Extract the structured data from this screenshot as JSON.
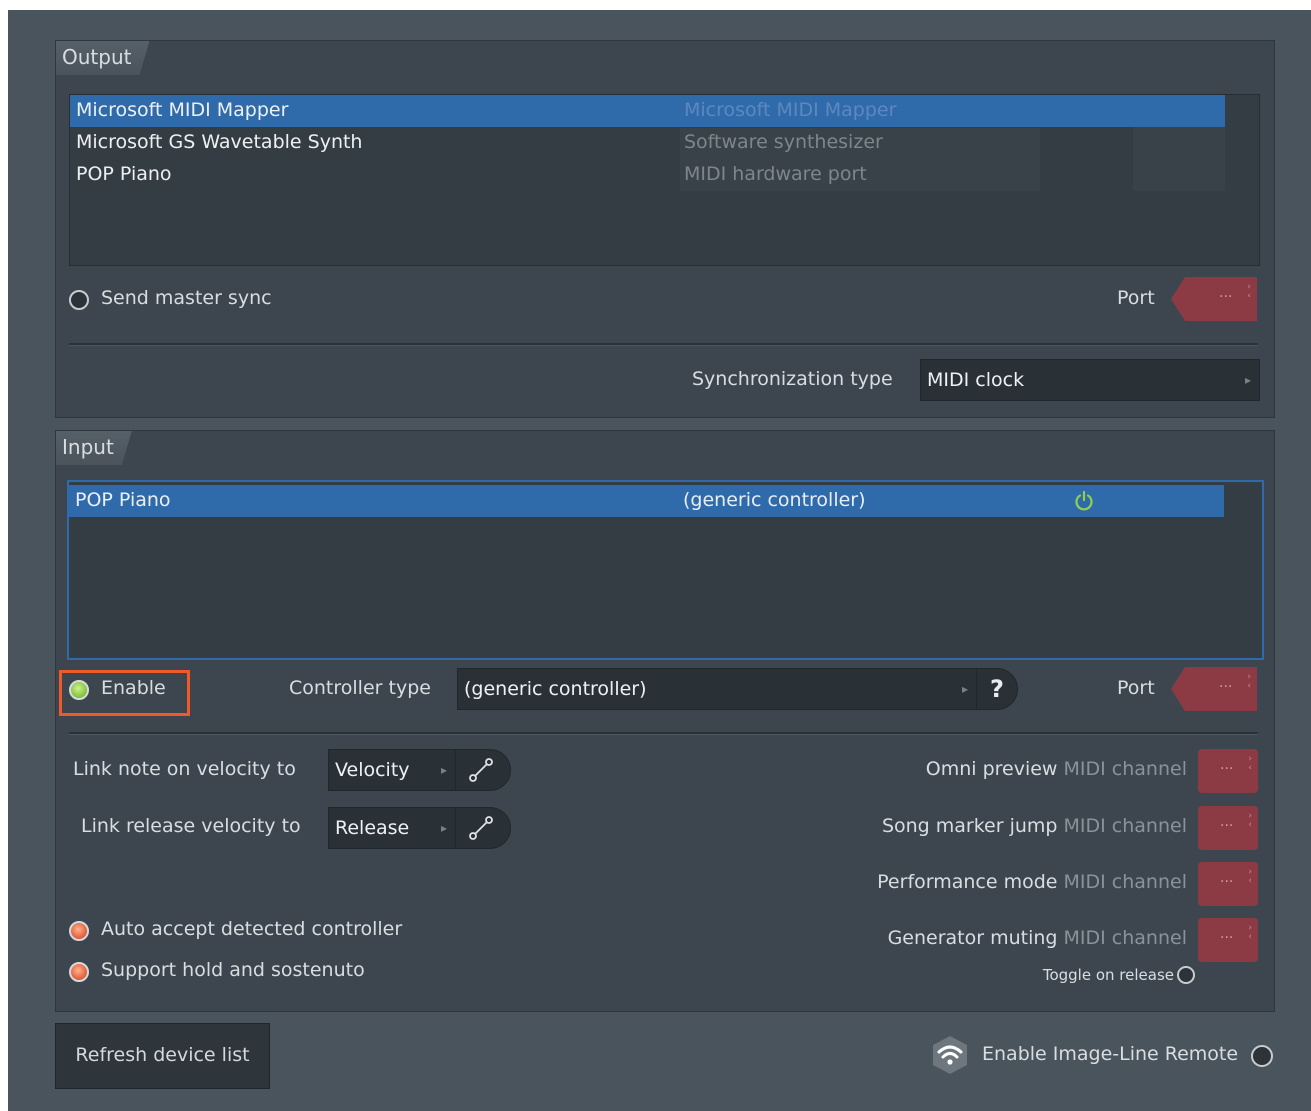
{
  "output": {
    "title": "Output",
    "devices": [
      {
        "name": "Microsoft MIDI Mapper",
        "type": "Microsoft MIDI Mapper",
        "selected": true
      },
      {
        "name": "Microsoft GS Wavetable Synth",
        "type": "Software synthesizer",
        "selected": false
      },
      {
        "name": "POP Piano",
        "type": "MIDI hardware port",
        "selected": false
      }
    ],
    "send_master_sync_label": "Send master sync",
    "port_label": "Port",
    "port_value": "···",
    "sync_type_label": "Synchronization type",
    "sync_type_value": "MIDI clock"
  },
  "input": {
    "title": "Input",
    "devices": [
      {
        "name": "POP Piano",
        "type": "(generic controller)",
        "selected": true,
        "enabled": true
      }
    ],
    "enable_label": "Enable",
    "controller_type_label": "Controller type",
    "controller_type_value": "(generic controller)",
    "help_label": "?",
    "port_label": "Port",
    "port_value": "···",
    "link_note_on_label": "Link note on velocity to",
    "link_note_on_value": "Velocity",
    "link_release_label": "Link release velocity to",
    "link_release_value": "Release",
    "auto_accept_label": "Auto accept detected controller",
    "support_hold_label": "Support hold and sostenuto",
    "channels": [
      {
        "label": "Omni preview",
        "suffix": "MIDI channel",
        "value": "···"
      },
      {
        "label": "Song marker jump",
        "suffix": "MIDI channel",
        "value": "···"
      },
      {
        "label": "Performance mode",
        "suffix": "MIDI channel",
        "value": "···"
      },
      {
        "label": "Generator muting",
        "suffix": "MIDI channel",
        "value": "···"
      }
    ],
    "toggle_on_release_label": "Toggle on release"
  },
  "footer": {
    "refresh_label": "Refresh device list",
    "remote_label": "Enable Image-Line Remote"
  },
  "colors": {
    "selection": "#2f6aab",
    "port": "#8c3b45",
    "highlight": "#f05a2a",
    "led_green": "#7fbf3a",
    "led_red": "#e05a3a"
  }
}
